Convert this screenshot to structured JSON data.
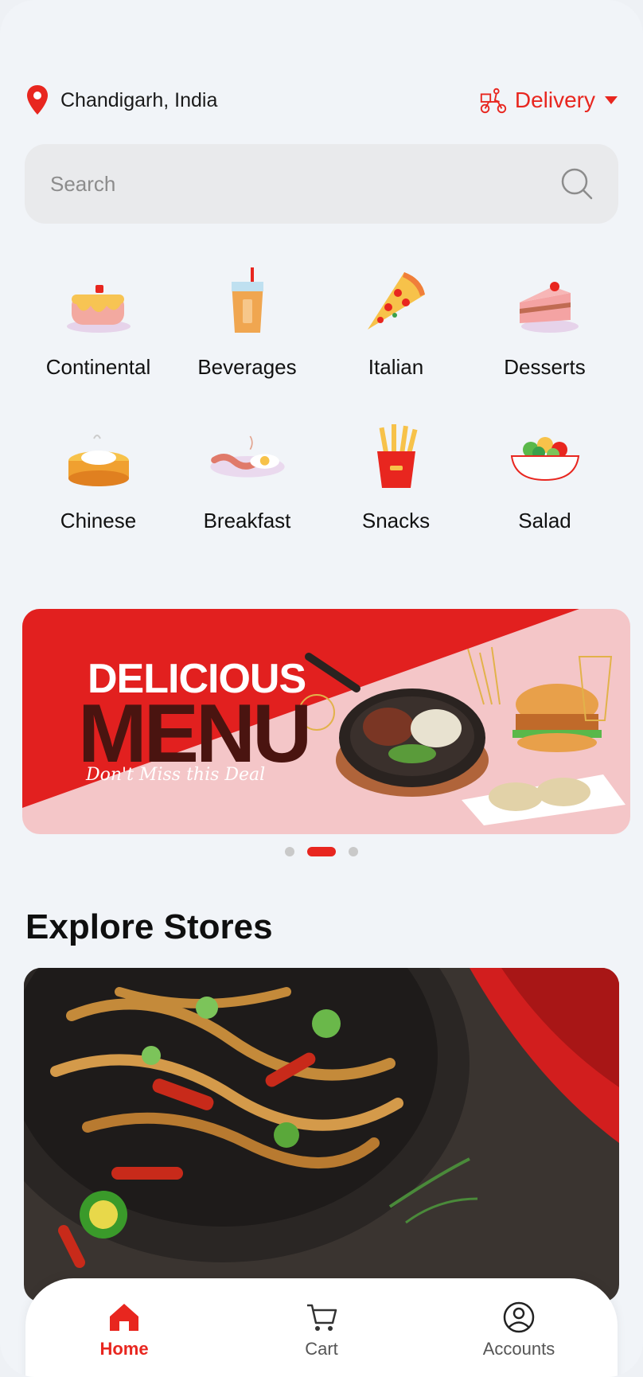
{
  "location": {
    "text": "Chandigarh, India",
    "icon": "map-pin-icon"
  },
  "mode": {
    "label": "Delivery",
    "icon": "scooter-icon"
  },
  "search": {
    "placeholder": "Search",
    "icon": "search-icon"
  },
  "categories": [
    {
      "label": "Continental",
      "icon": "pancake-icon"
    },
    {
      "label": "Beverages",
      "icon": "drink-icon"
    },
    {
      "label": "Italian",
      "icon": "pizza-icon"
    },
    {
      "label": "Desserts",
      "icon": "cake-icon"
    },
    {
      "label": "Chinese",
      "icon": "dumpling-icon"
    },
    {
      "label": "Breakfast",
      "icon": "bacon-egg-icon"
    },
    {
      "label": "Snacks",
      "icon": "fries-icon"
    },
    {
      "label": "Salad",
      "icon": "salad-icon"
    }
  ],
  "banner": {
    "title_line1": "DELICIOUS",
    "title_line2": "MENU",
    "subtitle": "Don't Miss this Deal",
    "slides": 3,
    "active_slide": 2
  },
  "explore": {
    "title": "Explore Stores"
  },
  "nav": [
    {
      "label": "Home",
      "icon": "home-icon",
      "active": true
    },
    {
      "label": "Cart",
      "icon": "cart-icon",
      "active": false
    },
    {
      "label": "Accounts",
      "icon": "account-icon",
      "active": false
    }
  ],
  "colors": {
    "accent": "#e8261f",
    "background": "#f1f4f8"
  }
}
